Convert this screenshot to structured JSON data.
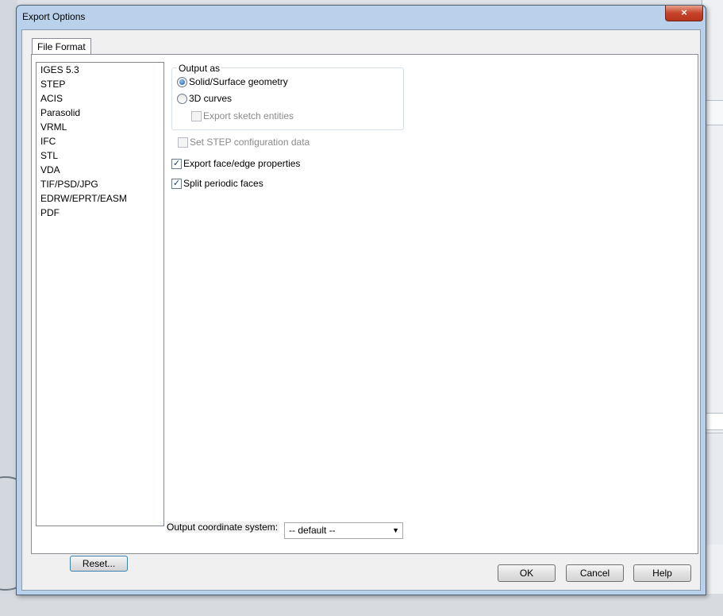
{
  "window": {
    "title": "Export Options",
    "close_symbol": "×"
  },
  "tabs": [
    {
      "label": "File Format",
      "selected": true
    }
  ],
  "format_list": {
    "items": [
      "IGES 5.3",
      "STEP",
      "ACIS",
      "Parasolid",
      "VRML",
      "IFC",
      "STL",
      "VDA",
      "TIF/PSD/JPG",
      "EDRW/EPRT/EASM",
      "PDF"
    ],
    "selected": "STEP"
  },
  "output_as": {
    "legend": "Output as",
    "options": [
      {
        "label": "Solid/Surface geometry",
        "selected": true
      },
      {
        "label": "3D curves",
        "selected": false
      }
    ],
    "export_sketch": {
      "label": "Export sketch entities",
      "checked": false,
      "enabled": false
    }
  },
  "options": {
    "step_config": {
      "label": "Set STEP configuration data",
      "checked": false,
      "enabled": false
    },
    "face_edge": {
      "label": "Export face/edge properties",
      "checked": true,
      "enabled": true
    },
    "split_faces": {
      "label": "Split periodic faces",
      "checked": true,
      "enabled": true
    }
  },
  "coordinate_system": {
    "label": "Output coordinate system:",
    "value": "-- default --"
  },
  "buttons": {
    "reset": "Reset...",
    "ok": "OK",
    "cancel": "Cancel",
    "help": "Help"
  },
  "check_mark": "✓",
  "dropdown_arrow": "▼"
}
